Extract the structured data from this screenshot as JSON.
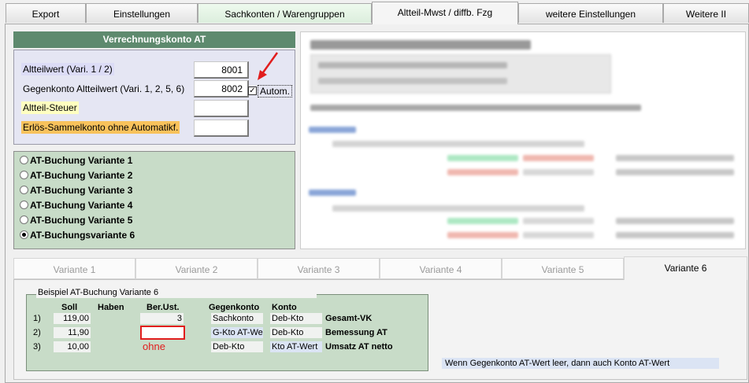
{
  "top_tabs": [
    {
      "label": "Export"
    },
    {
      "label": "Einstellungen"
    },
    {
      "label": "Sachkonten / Warengruppen"
    },
    {
      "label": "Altteil-Mwst / diffb. Fzg"
    },
    {
      "label": "weitere Einstellungen"
    },
    {
      "label": "Weitere II"
    }
  ],
  "settings": {
    "header": "Verrechnungskonto AT",
    "fields": [
      {
        "label": "Altteilwert (Vari. 1 / 2)",
        "value": "8001"
      },
      {
        "label": "Gegenkonto Altteilwert (Vari. 1, 2, 5, 6)",
        "value": "8002"
      },
      {
        "label": "Altteil-Steuer",
        "value": ""
      },
      {
        "label": "Erlös-Sammelkonto ohne Automatikf.",
        "value": ""
      }
    ],
    "autom_label": "Autom.",
    "autom_checked": true,
    "colors": {
      "field1": "#dcdcf6",
      "field2": "#e5e6f3",
      "field3": "#ffffc0",
      "field4": "#f8c25c",
      "arrow": "#e11d1d"
    }
  },
  "variants": {
    "items": [
      {
        "label": "AT-Buchung Variante 1",
        "selected": false
      },
      {
        "label": "AT-Buchung Variante 2",
        "selected": false
      },
      {
        "label": "AT-Buchung Variante 3",
        "selected": false
      },
      {
        "label": "AT-Buchung Variante 4",
        "selected": false
      },
      {
        "label": "AT-Buchung Variante 5",
        "selected": false
      },
      {
        "label": "AT-Buchungsvariante 6",
        "selected": true
      }
    ]
  },
  "variant_tabs": [
    {
      "label": "Variante 1"
    },
    {
      "label": "Variante 2"
    },
    {
      "label": "Variante 3"
    },
    {
      "label": "Variante 4"
    },
    {
      "label": "Variante 5"
    },
    {
      "label": "Variante 6"
    }
  ],
  "example": {
    "title": "Beispiel AT-Buchung Variante 6",
    "headers": {
      "soll": "Soll",
      "haben": "Haben",
      "berust": "Ber.Ust.",
      "gegenkonto": "Gegenkonto",
      "konto": "Konto"
    },
    "rows": [
      {
        "nr": "1)",
        "soll": "119,00",
        "haben": "",
        "berust": "3",
        "gegenkonto": "Sachkonto",
        "konto": "Deb-Kto",
        "desc": "Gesamt-VK"
      },
      {
        "nr": "2)",
        "soll": "11,90",
        "haben": "",
        "berust": "",
        "gegenkonto": "G-Kto AT-Wert",
        "konto": "Deb-Kto",
        "desc": "Bemessung AT"
      },
      {
        "nr": "3)",
        "soll": "10,00",
        "haben": "",
        "berust": "",
        "gegenkonto": "Deb-Kto",
        "konto": "Kto AT-Wert",
        "desc": "Umsatz AT netto"
      }
    ],
    "annotation": "ohne",
    "info": "Wenn Gegenkonto AT-Wert leer, dann auch Konto AT-Wert"
  }
}
